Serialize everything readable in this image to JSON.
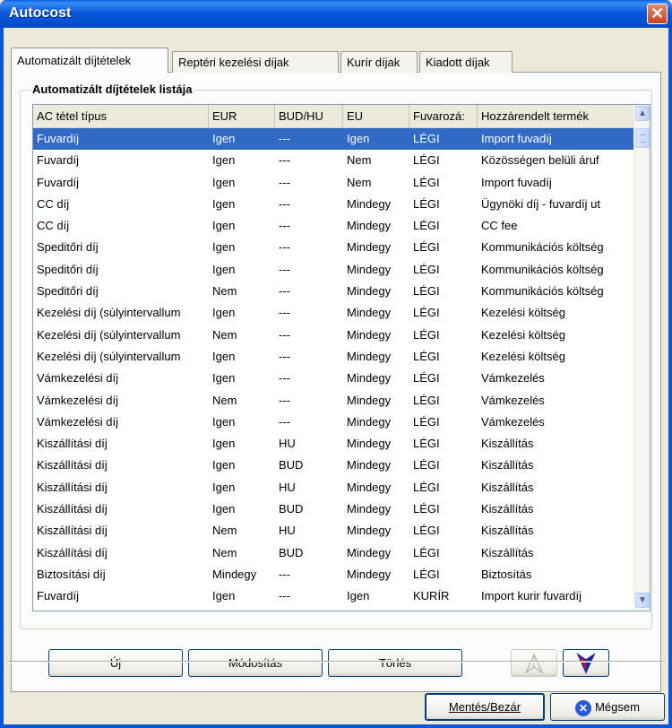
{
  "window": {
    "title": "Autocost",
    "close_glyph": "✕"
  },
  "tabs": [
    {
      "label": "Automatizált díjtételek",
      "active": true
    },
    {
      "label": "Reptéri kezelési díjak",
      "active": false
    },
    {
      "label": "Kurír díjak",
      "active": false
    },
    {
      "label": "Kiadott díjak",
      "active": false
    }
  ],
  "group": {
    "label": "Automatizált díjtételek listája"
  },
  "table": {
    "columns": [
      "AC tétel típus",
      "EUR",
      "BUD/HU",
      "EU",
      "Fuvarozá:",
      "Hozzárendelt termék"
    ],
    "rows": [
      [
        "Fuvardíj",
        "Igen",
        "---",
        "Igen",
        "LÉGI",
        "Import fuvadíj"
      ],
      [
        "Fuvardíj",
        "Igen",
        "---",
        "Nem",
        "LÉGI",
        "Közösségen belüli áruf"
      ],
      [
        "Fuvardíj",
        "Igen",
        "---",
        "Nem",
        "LÉGI",
        "Import fuvadíj"
      ],
      [
        "CC díj",
        "Igen",
        "---",
        "Mindegy",
        "LÉGI",
        "Ügynöki díj - fuvardíj ut"
      ],
      [
        "CC díj",
        "Igen",
        "---",
        "Mindegy",
        "LÉGI",
        "CC fee"
      ],
      [
        "Speditőri díj",
        "Igen",
        "---",
        "Mindegy",
        "LÉGI",
        "Kommunikációs költség"
      ],
      [
        "Speditőri díj",
        "Igen",
        "---",
        "Mindegy",
        "LÉGI",
        "Kommunikációs költség"
      ],
      [
        "Speditőri díj",
        "Nem",
        "---",
        "Mindegy",
        "LÉGI",
        "Kommunikációs költség"
      ],
      [
        "Kezelési díj (súlyintervallum",
        "Igen",
        "---",
        "Mindegy",
        "LÉGI",
        "Kezelési költség"
      ],
      [
        "Kezelési díj (súlyintervallum",
        "Nem",
        "---",
        "Mindegy",
        "LÉGI",
        "Kezelési költség"
      ],
      [
        "Kezelési díj (súlyintervallum",
        "Igen",
        "---",
        "Mindegy",
        "LÉGI",
        "Kezelési költség"
      ],
      [
        "Vámkezelési díj",
        "Igen",
        "---",
        "Mindegy",
        "LÉGI",
        "Vámkezelés"
      ],
      [
        "Vámkezelési díj",
        "Nem",
        "---",
        "Mindegy",
        "LÉGI",
        "Vámkezelés"
      ],
      [
        "Vámkezelési díj",
        "Igen",
        "---",
        "Mindegy",
        "LÉGI",
        "Vámkezelés"
      ],
      [
        "Kiszállítási díj",
        "Igen",
        "HU",
        "Mindegy",
        "LÉGI",
        "Kiszállítás"
      ],
      [
        "Kiszállítási díj",
        "Igen",
        "BUD",
        "Mindegy",
        "LÉGI",
        "Kiszállítás"
      ],
      [
        "Kiszállítási díj",
        "Igen",
        "HU",
        "Mindegy",
        "LÉGI",
        "Kiszállítás"
      ],
      [
        "Kiszállítási díj",
        "Igen",
        "BUD",
        "Mindegy",
        "LÉGI",
        "Kiszállítás"
      ],
      [
        "Kiszállítási díj",
        "Nem",
        "HU",
        "Mindegy",
        "LÉGI",
        "Kiszállítás"
      ],
      [
        "Kiszállítási díj",
        "Nem",
        "BUD",
        "Mindegy",
        "LÉGI",
        "Kiszállítás"
      ],
      [
        "Biztosítási díj",
        "Mindegy",
        "---",
        "Mindegy",
        "LÉGI",
        "Biztosítás"
      ],
      [
        "Fuvardíj",
        "Igen",
        "---",
        "Igen",
        "KURÍR",
        "Import kurir fuvardíj"
      ]
    ],
    "selected_row": 0
  },
  "buttons": {
    "new": "Új",
    "modify": "Módosítás",
    "delete": "Törlés",
    "save_close": "Mentés/Bezár",
    "cancel": "Mégsem"
  },
  "icons": {
    "close": "close-icon",
    "scroll_up": "chevron-up-icon",
    "scroll_down": "chevron-down-icon",
    "move_up": "arrow-up-icon",
    "move_down": "arrow-down-icon",
    "cancel": "cancel-icon"
  },
  "colors": {
    "title_bar": "#0a58dd",
    "selection": "#316ac5",
    "arrow_down": "#c8102e",
    "arrow_down_outline": "#1a2aa6"
  }
}
